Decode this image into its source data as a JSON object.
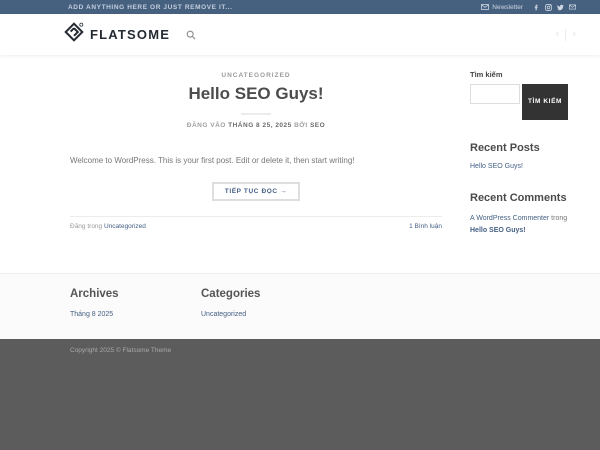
{
  "colors": {
    "topbar_bg": "#46617f",
    "link": "#446084",
    "logo_text": "#252b33",
    "search_button_bg": "#333333",
    "dark_footer_bg": "#5c5c5c"
  },
  "icons": {
    "logo_mark": "flatsome-diamond",
    "newsletter": "envelope-icon",
    "social": [
      "facebook-icon",
      "instagram-icon",
      "twitter-icon",
      "email-icon"
    ],
    "header_search": "magnifier-icon",
    "nav_prev": "chevron-left-icon",
    "nav_next": "chevron-right-icon"
  },
  "topbar": {
    "left_text": "ADD ANYTHING HERE OR JUST REMOVE IT...",
    "newsletter_label": "Newsletter"
  },
  "header": {
    "logo_text": "FLATSOME",
    "nav_prev": "‹",
    "nav_next": "›"
  },
  "post": {
    "category": "UNCATEGORIZED",
    "title": "Hello SEO Guys!",
    "meta_prefix": "ĐĂNG VÀO ",
    "meta_date": "THÁNG 8 25, 2025",
    "meta_by": " BỞI ",
    "meta_author": "SEO",
    "excerpt": "Welcome to WordPress. This is your first post. Edit or delete it, then start writing!",
    "read_more_label": "TIẾP TỤC ĐỌC →",
    "posted_in_label": "Đăng trong ",
    "posted_in_category": "Uncategorized",
    "comments_link": "1 Bình luận"
  },
  "sidebar": {
    "search_label": "Tìm kiếm",
    "search_button_label": "TÌM KIẾM",
    "search_value": "",
    "recent_posts_title": "Recent Posts",
    "recent_posts": [
      "Hello SEO Guys!"
    ],
    "recent_comments_title": "Recent Comments",
    "recent_comments": [
      {
        "author": "A WordPress Commenter",
        "connector": " trong ",
        "post": "Hello SEO Guys!"
      }
    ]
  },
  "footer": {
    "archives_title": "Archives",
    "archives": [
      "Tháng 8 2025"
    ],
    "categories_title": "Categories",
    "categories": [
      "Uncategorized"
    ],
    "copyright": "Copyright 2025 © Flatsome Theme"
  }
}
